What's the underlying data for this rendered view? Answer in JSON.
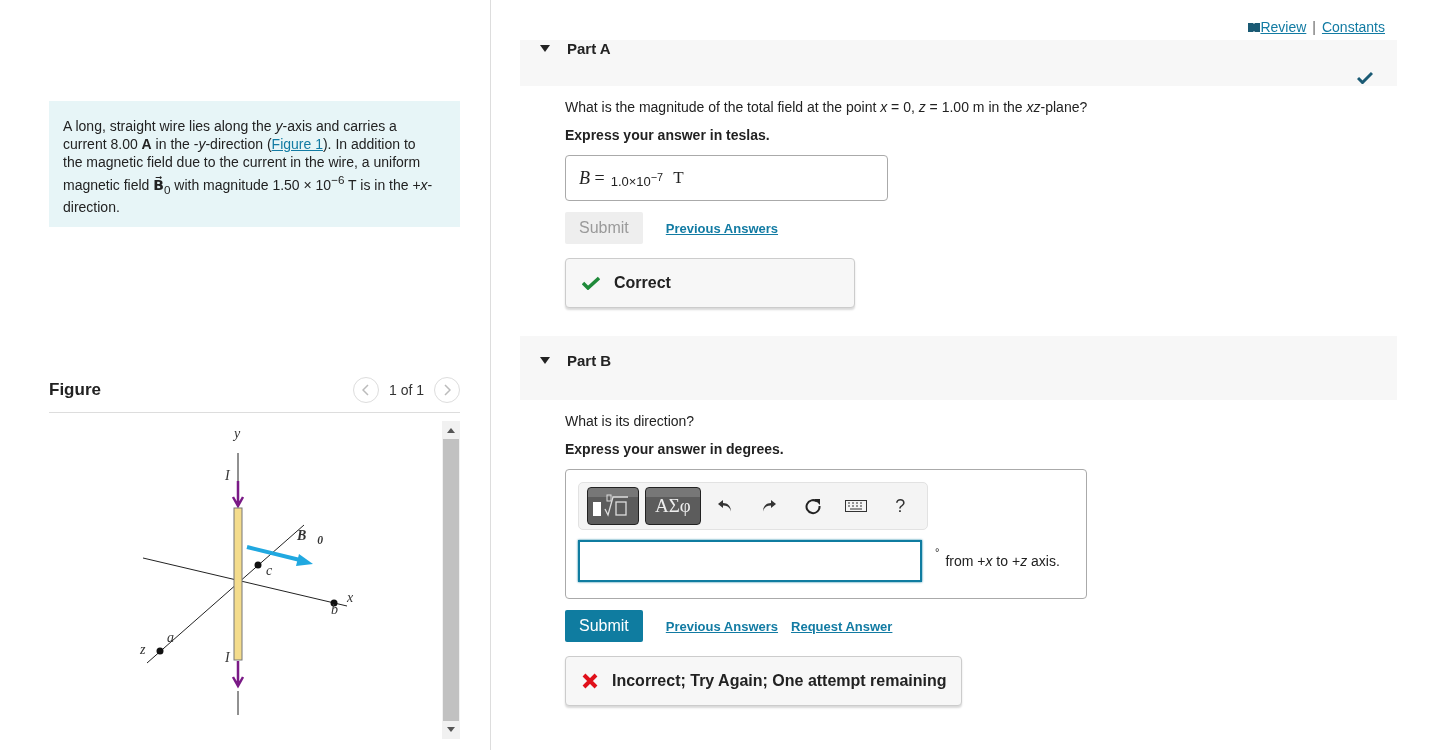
{
  "problem": {
    "before": "A long, straight wire lies along the *y*-axis and carries a current 8.00 **A** in the -*y*-direction (",
    "link": "Figure 1",
    "after": "). In addition to the magnetic field due to the current in the wire, a uniform magnetic field **B⃗**$_{0}$ with magnitude 1.50 × 10$^{−6}$ T is in the +*x*-direction."
  },
  "figure": {
    "title": "Figure",
    "pager": "1 of 1",
    "prev_disabled": true,
    "next_disabled": true,
    "labels": [
      {
        "kind": "y-axis",
        "text": "y"
      },
      {
        "kind": "current-top",
        "text": "I"
      },
      {
        "kind": "field",
        "text": "B⃗$_{0}$"
      },
      {
        "kind": "point-c",
        "text": "c"
      },
      {
        "kind": "x-axis",
        "text": "x"
      },
      {
        "kind": "point-b",
        "text": "b"
      },
      {
        "kind": "z-axis",
        "text": "z"
      },
      {
        "kind": "point-a",
        "text": "a"
      },
      {
        "kind": "current-bottom",
        "text": "I"
      }
    ]
  },
  "top_links": [
    {
      "kind": "review",
      "text": " Review"
    },
    {
      "kind": "constants",
      "text": "Constants"
    }
  ],
  "top_separator": "|",
  "parts": [
    {
      "kind": "numeric",
      "title": "Part A",
      "expanded": true,
      "completed": true,
      "question": "What is the magnitude of the total field at the point *x* = 0, *z* = 1.00 m in the *xz*-plane?",
      "instruction": "Express your answer in teslas.",
      "answer": {
        "variable": "*B* =",
        "value": "1.0×10$^{−7}$",
        "unit": "T"
      },
      "submit": {
        "label": "Submit",
        "disabled": true
      },
      "links": [
        "Previous Answers"
      ],
      "feedback": {
        "kind": "correct",
        "text": "Correct"
      }
    },
    {
      "kind": "editor",
      "title": "Part B",
      "expanded": true,
      "completed": false,
      "question": "What is its direction?",
      "instruction": "Express your answer in degrees.",
      "toolbar": {
        "symbols": "ΑΣφ",
        "help": "?"
      },
      "answer": {
        "focused": true,
        "degree": "°",
        "unit": "from +*x* to +*z* axis."
      },
      "submit": {
        "label": "Submit",
        "disabled": false
      },
      "links": [
        "Previous Answers",
        "Request Answer"
      ],
      "feedback": {
        "kind": "incorrect",
        "text": "Incorrect; Try Again; One attempt remaining"
      }
    }
  ]
}
